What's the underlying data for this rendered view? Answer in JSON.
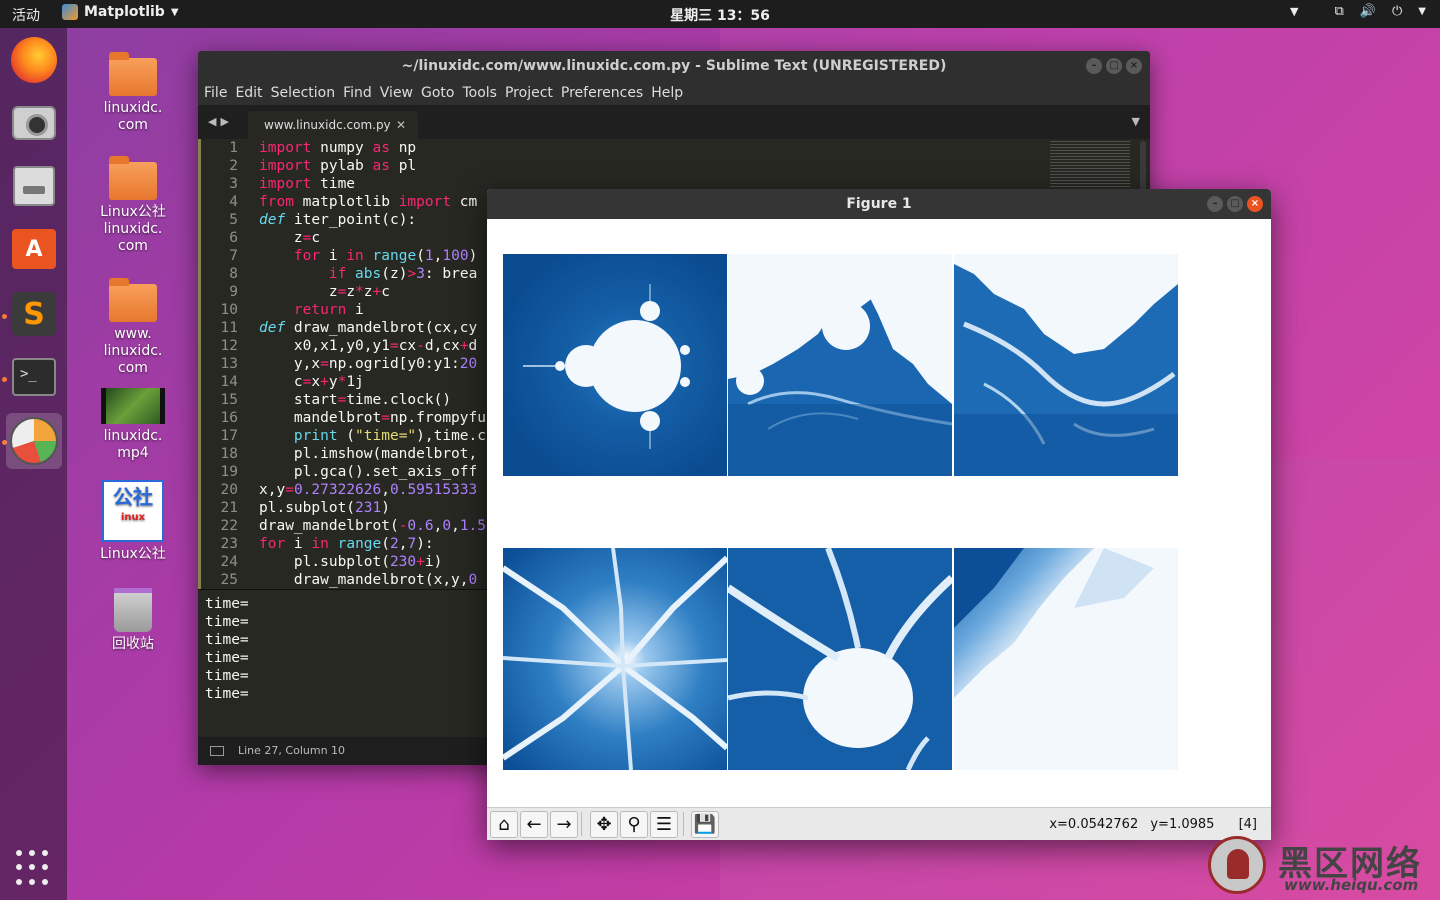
{
  "topbar": {
    "activities": "活动",
    "app_name": "Matplotlib",
    "clock": "星期三 13：56"
  },
  "dock": [
    "firefox",
    "camera",
    "files",
    "software-store",
    "sublime-text",
    "terminal",
    "matplotlib-figure"
  ],
  "desktop_icons": [
    {
      "lines": [
        "linuxidc.",
        "com"
      ],
      "kind": "folder"
    },
    {
      "lines": [
        "Linux公社",
        "linuxidc.",
        "com"
      ],
      "kind": "folder"
    },
    {
      "lines": [
        "www.",
        "linuxidc.",
        "com"
      ],
      "kind": "folder"
    },
    {
      "lines": [
        "linuxidc.",
        "mp4"
      ],
      "kind": "video"
    },
    {
      "lines": [
        "Linux公社"
      ],
      "kind": "logo",
      "logo_text": "公社",
      "logo_sub": "inux"
    },
    {
      "lines": [
        "回收站"
      ],
      "kind": "trash"
    }
  ],
  "sublime": {
    "title": "~/linuxidc.com/www.linuxidc.com.py - Sublime Text (UNREGISTERED)",
    "menu": [
      "File",
      "Edit",
      "Selection",
      "Find",
      "View",
      "Goto",
      "Tools",
      "Project",
      "Preferences",
      "Help"
    ],
    "tab": "www.linuxidc.com.py",
    "code_lines": [
      "import numpy as np",
      "import pylab as pl",
      "import time",
      "from matplotlib import cm",
      "def iter_point(c):",
      "    z=c",
      "    for i in range(1,100)",
      "        if abs(z)>3: brea",
      "        z=z*z+c",
      "    return i",
      "def draw_mandelbrot(cx,cy",
      "    x0,x1,y0,y1=cx-d,cx+d",
      "    y,x=np.ogrid[y0:y1:20",
      "    c=x+y*1j",
      "    start=time.clock()",
      "    mandelbrot=np.frompyfu",
      "    print (\"time=\"),time.c",
      "    pl.imshow(mandelbrot,",
      "    pl.gca().set_axis_off",
      "x,y=0.27322626,0.59515333",
      "pl.subplot(231)",
      "draw_mandelbrot(-0.6,0,1.5",
      "for i in range(2,7):",
      "    pl.subplot(230+i)",
      "    draw_mandelbrot(x,y,0"
    ],
    "console_lines": [
      "time=",
      "time=",
      "time=",
      "time=",
      "time=",
      "time="
    ],
    "status": "Line 27, Column 10"
  },
  "figure": {
    "title": "Figure 1",
    "toolbar": [
      {
        "icon": "home-icon",
        "glyph": "⌂"
      },
      {
        "icon": "back-arrow-icon",
        "glyph": "←"
      },
      {
        "icon": "forward-arrow-icon",
        "glyph": "→"
      },
      {
        "icon": "pan-icon",
        "glyph": "✥"
      },
      {
        "icon": "zoom-icon",
        "glyph": "⚲"
      },
      {
        "icon": "subplots-config-icon",
        "glyph": "☰"
      },
      {
        "icon": "save-icon",
        "glyph": "💾"
      }
    ],
    "coords_x": "x=0.0542762",
    "coords_y": "y=1.0985",
    "coords_idx": "[4]"
  },
  "watermark": {
    "text": "黑区网络",
    "url": "www.heiqu.com"
  }
}
